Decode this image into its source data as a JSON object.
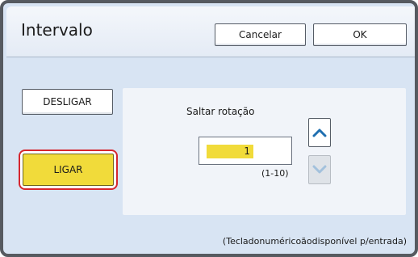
{
  "dialog": {
    "title": "Intervalo",
    "cancel_label": "Cancelar",
    "ok_label": "OK"
  },
  "mode": {
    "off_label": "DESLIGAR",
    "on_label": "LIGAR",
    "selected": "LIGAR",
    "selected_color": "#f1db3a",
    "highlight_color": "#d6262e"
  },
  "interval": {
    "label": "Saltar rotação",
    "value": "1",
    "range": "(1-10)",
    "up_icon": "chevron-up-icon",
    "down_icon": "chevron-down-icon",
    "down_enabled": false
  },
  "footer": {
    "note": "(Tecladonuméricoãodisponível p/entrada)"
  }
}
